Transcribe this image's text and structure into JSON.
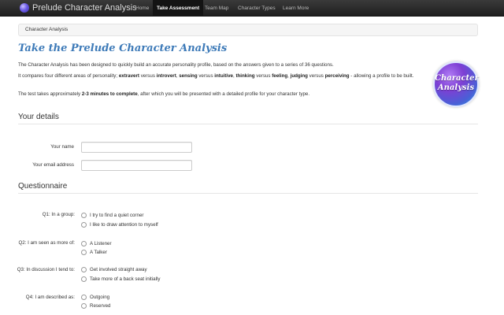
{
  "navbar": {
    "brand": "Prelude Character Analysis",
    "items": [
      {
        "label": "Home"
      },
      {
        "label": "Take Assessment"
      },
      {
        "label": "Team Map"
      },
      {
        "label": "Character Types"
      },
      {
        "label": "Learn More"
      }
    ]
  },
  "breadcrumb": "Character Analysis",
  "page_title": "Take the Prelude Character Analysis",
  "intro": {
    "p1": "The Character Analysis has been designed to quickly build an accurate personality profile, based on the answers given to a series of 36 questions.",
    "p2": {
      "a": "It compares four different areas of personality; ",
      "t1": "extravert",
      "b": " versus ",
      "t2": "introvert",
      "c": ", ",
      "t3": "sensing",
      "d": " versus ",
      "t4": "intuitive",
      "e": ", ",
      "t5": "thinking",
      "f": " versus ",
      "t6": "feeling",
      "g": ", ",
      "t7": "judging",
      "h": " versus ",
      "t8": "perceiving",
      "i": " - allowing a profile to be built."
    },
    "p3": {
      "a": "The test takes approximately ",
      "bold": "2-3 minutes to complete",
      "b": ", after which you will be presented with a detailed profile for your character type."
    }
  },
  "logo_text": {
    "line1": "Character",
    "line2": "Analysis"
  },
  "details": {
    "title": "Your details",
    "name_label": "Your name",
    "email_label": "Your email address",
    "name_value": "",
    "email_value": ""
  },
  "questionnaire": {
    "title": "Questionnaire",
    "questions": [
      {
        "label": "Q1: In a group:",
        "options": [
          "I try to find a quiet corner",
          "I like to draw attention to myself"
        ]
      },
      {
        "label": "Q2: I am seen as more of:",
        "options": [
          "A Listener",
          "A Talker"
        ]
      },
      {
        "label": "Q3: In discussion I tend to:",
        "options": [
          "Get involved straight away",
          "Take more of a back seat initially"
        ]
      },
      {
        "label": "Q4: I am described as:",
        "options": [
          "Outgoing",
          "Reserved"
        ]
      }
    ]
  }
}
